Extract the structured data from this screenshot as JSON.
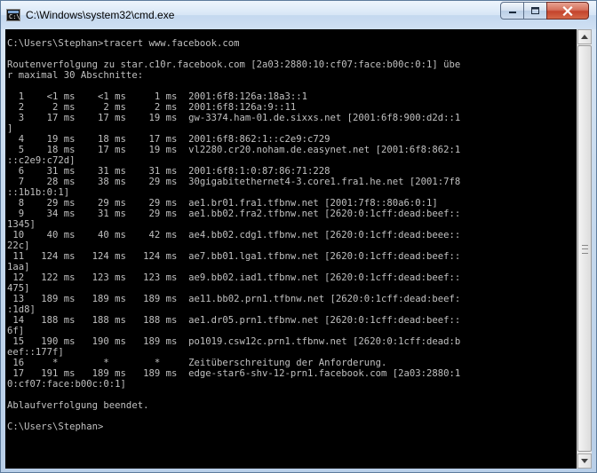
{
  "window": {
    "title": "C:\\Windows\\system32\\cmd.exe",
    "icon_label": "C:\\"
  },
  "controls": {
    "minimize": "minimize-icon",
    "maximize": "maximize-icon",
    "close": "close-icon"
  },
  "console": {
    "colors": {
      "background": "#000000",
      "text": "#c0c0c0"
    },
    "lines": [
      "C:\\Users\\Stephan>tracert www.facebook.com",
      "",
      "Routenverfolgung zu star.c10r.facebook.com [2a03:2880:10:cf07:face:b00c:0:1] übe",
      "r maximal 30 Abschnitte:",
      "",
      "  1    <1 ms    <1 ms     1 ms  2001:6f8:126a:18a3::1",
      "  2     2 ms     2 ms     2 ms  2001:6f8:126a:9::11",
      "  3    17 ms    17 ms    19 ms  gw-3374.ham-01.de.sixxs.net [2001:6f8:900:d2d::1",
      "]",
      "  4    19 ms    18 ms    17 ms  2001:6f8:862:1::c2e9:c729",
      "  5    18 ms    17 ms    19 ms  vl2280.cr20.noham.de.easynet.net [2001:6f8:862:1",
      "::c2e9:c72d]",
      "  6    31 ms    31 ms    31 ms  2001:6f8:1:0:87:86:71:228",
      "  7    28 ms    38 ms    29 ms  30gigabitethernet4-3.core1.fra1.he.net [2001:7f8",
      "::1b1b:0:1]",
      "  8    29 ms    29 ms    29 ms  ae1.br01.fra1.tfbnw.net [2001:7f8::80a6:0:1]",
      "  9    34 ms    31 ms    29 ms  ae1.bb02.fra2.tfbnw.net [2620:0:1cff:dead:beef::",
      "1345]",
      " 10    40 ms    40 ms    42 ms  ae4.bb02.cdg1.tfbnw.net [2620:0:1cff:dead:beee::",
      "22c]",
      " 11   124 ms   124 ms   124 ms  ae7.bb01.lga1.tfbnw.net [2620:0:1cff:dead:beef::",
      "1aa]",
      " 12   122 ms   123 ms   123 ms  ae9.bb02.iad1.tfbnw.net [2620:0:1cff:dead:beef::",
      "475]",
      " 13   189 ms   189 ms   189 ms  ae11.bb02.prn1.tfbnw.net [2620:0:1cff:dead:beef:",
      ":1d8]",
      " 14   188 ms   188 ms   188 ms  ae1.dr05.prn1.tfbnw.net [2620:0:1cff:dead:beef::",
      "6f]",
      " 15   190 ms   190 ms   189 ms  po1019.csw12c.prn1.tfbnw.net [2620:0:1cff:dead:b",
      "eef::177f]",
      " 16     *        *        *     Zeitüberschreitung der Anforderung.",
      " 17   191 ms   189 ms   189 ms  edge-star6-shv-12-prn1.facebook.com [2a03:2880:1",
      "0:cf07:face:b00c:0:1]",
      "",
      "Ablaufverfolgung beendet.",
      "",
      "C:\\Users\\Stephan>"
    ]
  }
}
